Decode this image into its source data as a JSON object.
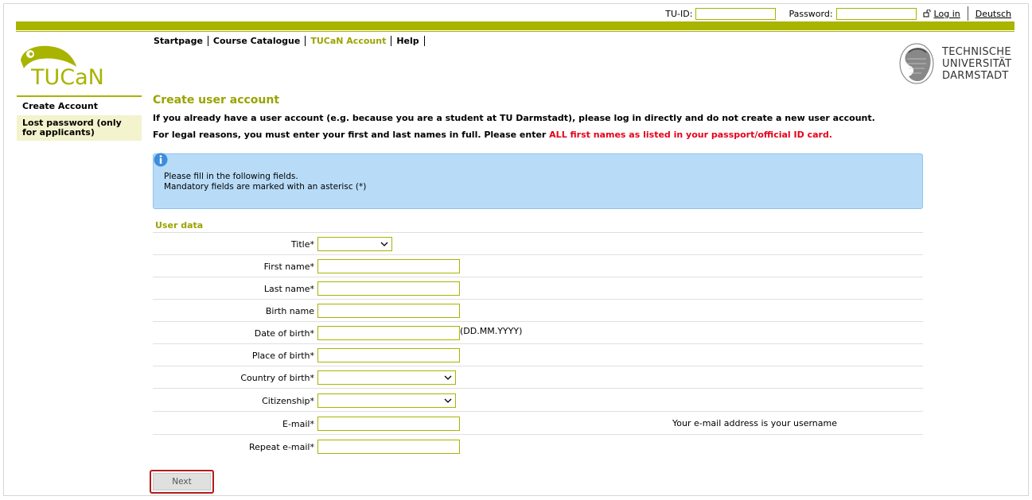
{
  "topbar": {
    "tuid_label": "TU-ID:",
    "password_label": "Password:",
    "login_label": "Log in",
    "language_label": "Deutsch"
  },
  "logo": {
    "text": "TUCaN"
  },
  "nav": {
    "items": [
      {
        "label": "Startpage"
      },
      {
        "label": "Course Catalogue"
      },
      {
        "label": "TUCaN Account"
      },
      {
        "label": "Help"
      }
    ]
  },
  "university": {
    "line1": "TECHNISCHE",
    "line2": "UNIVERSITÄT",
    "line3": "DARMSTADT"
  },
  "sidebar": {
    "items": [
      {
        "label": "Create Account"
      },
      {
        "label": "Lost password (only for applicants)"
      }
    ]
  },
  "main": {
    "title": "Create user account",
    "intro": "If you already have a user account (e.g. because you are a student at TU Darmstadt), please log in directly and do not create a new user account.",
    "legal_prefix": "For legal reasons, you must enter your first and last names in full. Please enter ",
    "legal_highlight": "ALL first names as listed in your passport/official ID card.",
    "info_line1": "Please fill in the following fields.",
    "info_line2": "Mandatory fields are marked with an asterisc (*)",
    "section_title": "User data"
  },
  "form": {
    "title_label": "Title*",
    "first_name_label": "First name*",
    "last_name_label": "Last name*",
    "birth_name_label": "Birth name",
    "dob_label": "Date of birth*",
    "dob_hint": "(DD.MM.YYYY)",
    "place_label": "Place of birth*",
    "country_label": "Country of birth*",
    "citizenship_label": "Citizenship*",
    "email_label": "E-mail*",
    "email_note": "Your e-mail address is your username",
    "repeat_email_label": "Repeat e-mail*"
  },
  "actions": {
    "next_label": "Next"
  },
  "colors": {
    "accent": "#a8b400",
    "highlight_red": "#e6001a",
    "info_bg": "#b8dcf8"
  }
}
